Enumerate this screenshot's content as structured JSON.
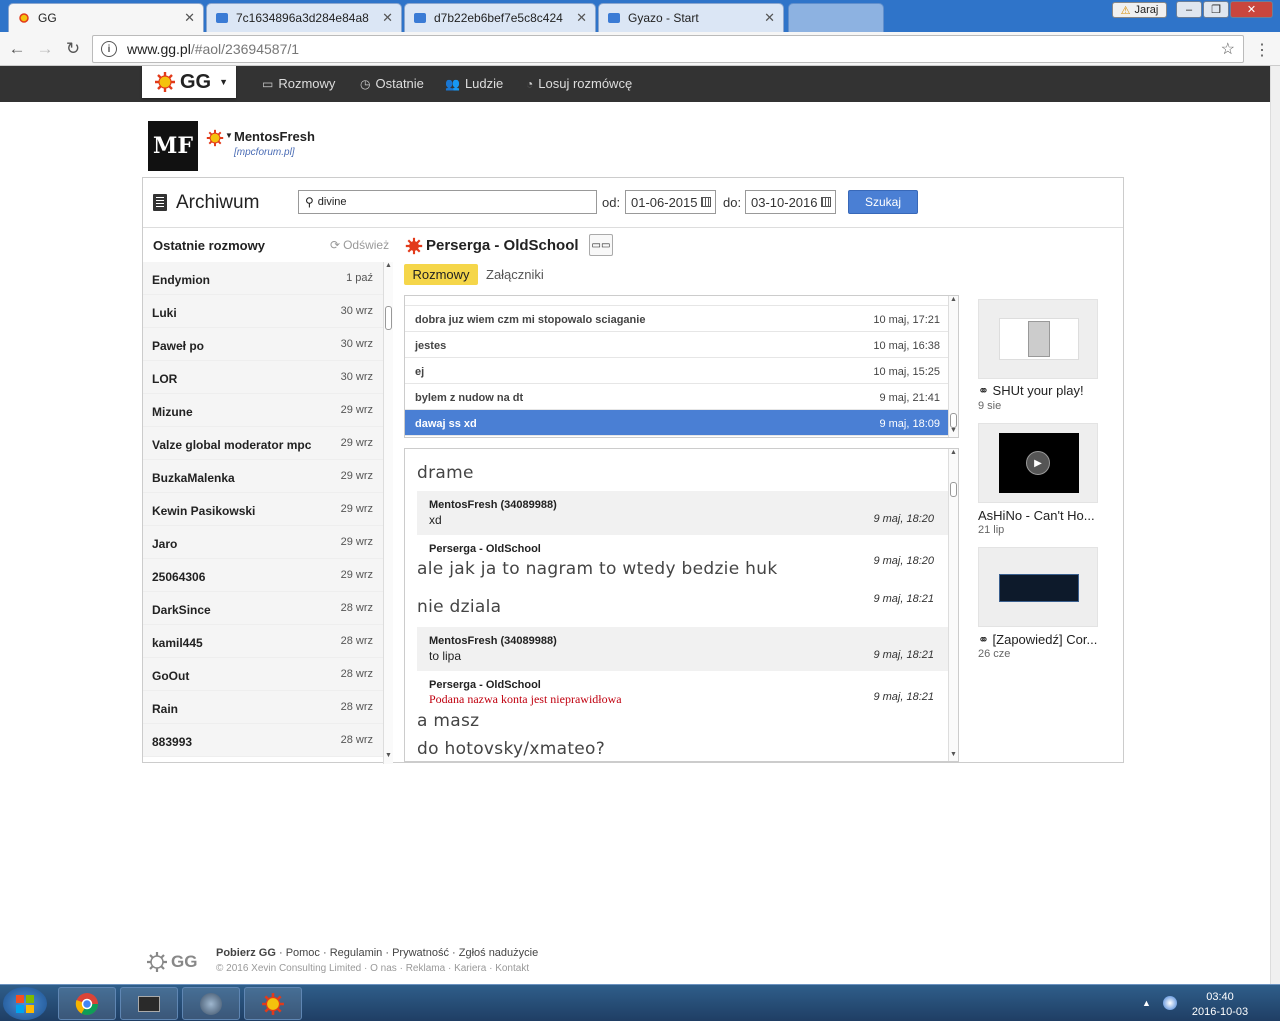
{
  "browser": {
    "tabs": [
      {
        "label": "GG",
        "active": true
      },
      {
        "label": "7c1634896a3d284e84a8",
        "active": false
      },
      {
        "label": "d7b22eb6bef7e5c8c424",
        "active": false
      },
      {
        "label": "Gyazo - Start",
        "active": false
      }
    ],
    "profile_label": "Jaraj",
    "url_host": "www.gg.pl",
    "url_path": "/#aol/23694587/1"
  },
  "topnav": {
    "logo": "GG",
    "items": [
      {
        "label": "Rozmowy",
        "icon": "chat-icon"
      },
      {
        "label": "Ostatnie",
        "icon": "clock-icon"
      },
      {
        "label": "Ludzie",
        "icon": "people-icon"
      },
      {
        "label": "Losuj rozmówcę",
        "icon": "random-icon"
      }
    ]
  },
  "profile": {
    "avatar_text": "MF",
    "name": "MentosFresh",
    "description": "[mpcforum.pl]"
  },
  "archive": {
    "title": "Archiwum",
    "search_value": "divine",
    "from_label": "od:",
    "from_date": "01-06-2015",
    "to_label": "do:",
    "to_date": "03-10-2016",
    "search_button": "Szukaj"
  },
  "recent": {
    "title": "Ostatnie rozmowy",
    "refresh": "Odśwież",
    "items": [
      {
        "name": "Endymion",
        "date": "1 paź"
      },
      {
        "name": "Luki",
        "date": "30 wrz"
      },
      {
        "name": "Paweł po",
        "date": "30 wrz"
      },
      {
        "name": "LOR",
        "date": "30 wrz"
      },
      {
        "name": "Mizune",
        "date": "29 wrz"
      },
      {
        "name": "Valze global moderator mpc",
        "date": "29 wrz"
      },
      {
        "name": "BuzkaMalenka",
        "date": "29 wrz"
      },
      {
        "name": "Kewin Pasikowski",
        "date": "29 wrz"
      },
      {
        "name": "Jaro",
        "date": "29 wrz"
      },
      {
        "name": "25064306",
        "date": "29 wrz"
      },
      {
        "name": "DarkSince",
        "date": "28 wrz"
      },
      {
        "name": "kamil445",
        "date": "28 wrz"
      },
      {
        "name": "GoOut",
        "date": "28 wrz"
      },
      {
        "name": "Rain",
        "date": "28 wrz"
      },
      {
        "name": "883993",
        "date": "28 wrz"
      }
    ]
  },
  "chat": {
    "title": "Perserga - OldSchool",
    "tab_conversations": "Rozmowy",
    "tab_attachments": "Załączniki",
    "threads": [
      {
        "text": "dobra juz wiem czm mi stopowalo sciaganie",
        "date": "10 maj, 17:21"
      },
      {
        "text": "jestes",
        "date": "10 maj, 16:38"
      },
      {
        "text": "ej",
        "date": "10 maj, 15:25"
      },
      {
        "text": "bylem z nudow na dt",
        "date": "9 maj, 21:41"
      },
      {
        "text": "dawaj ss xd",
        "date": "9 maj, 18:09"
      }
    ],
    "messages": {
      "m0_text": "drame",
      "m1_author": "MentosFresh (34089988)",
      "m1_text": "xd",
      "m1_time": "9 maj, 18:20",
      "m2_author": "Perserga - OldSchool",
      "m2_text": "ale jak ja to nagram to wtedy bedzie huk",
      "m2_time": "9 maj, 18:20",
      "m3_text": "nie dziala",
      "m3_time": "9 maj, 18:21",
      "m4_author": "MentosFresh (34089988)",
      "m4_text": "to lipa",
      "m4_time": "9 maj, 18:21",
      "m5_author": "Perserga - OldSchool",
      "m5_error": "Podana nazwa konta jest nieprawidłowa",
      "m5_time": "9 maj, 18:21",
      "m6_text": "a masz",
      "m7_text": "do hotovsky/xmateo?"
    }
  },
  "attachments": [
    {
      "title": "SHUt your play!",
      "date": "9 sie"
    },
    {
      "title": "AsHiNo - Can't Ho...",
      "date": "21 lip"
    },
    {
      "title": "[Zapowiedź] Cor...",
      "date": "26 cze"
    }
  ],
  "footer": {
    "logo": "GG",
    "links": [
      "Pobierz GG",
      "Pomoc",
      "Regulamin",
      "Prywatność",
      "Zgłoś nadużycie"
    ],
    "copyright": "© 2016 Xevin Consulting Limited",
    "links2": [
      "O nas",
      "Reklama",
      "Kariera",
      "Kontakt"
    ]
  },
  "taskbar": {
    "time": "03:40",
    "date": "2016-10-03"
  },
  "colors": {
    "accent": "#4a7fd4",
    "highlight": "#f5d64a",
    "topbar": "#333333",
    "error_text": "#c0000f"
  }
}
